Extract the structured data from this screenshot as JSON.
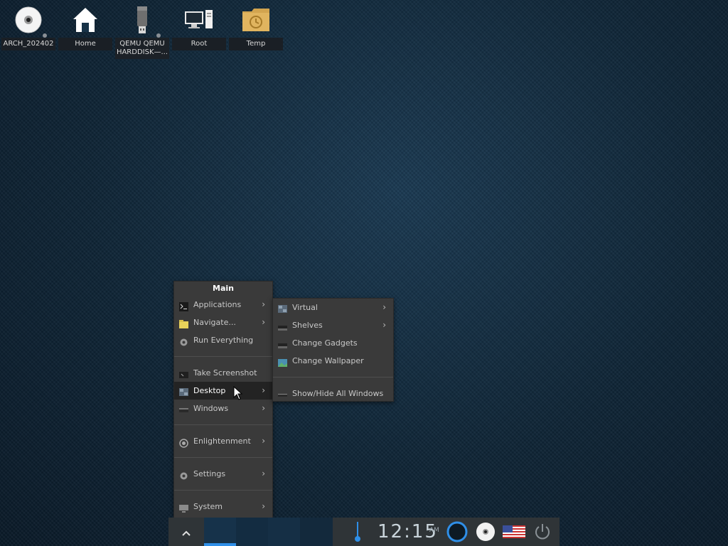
{
  "desktop": {
    "icons": [
      {
        "label": "ARCH_202402",
        "icon": "optical-disc-icon"
      },
      {
        "label": "Home",
        "icon": "home-icon"
      },
      {
        "label": "QEMU QEMU HARDDISK—...",
        "icon": "usb-drive-icon"
      },
      {
        "label": "Root",
        "icon": "computer-icon"
      },
      {
        "label": "Temp",
        "icon": "folder-clock-icon"
      }
    ]
  },
  "main_menu": {
    "title": "Main",
    "items": [
      {
        "label": "Applications",
        "icon": "terminal-icon"
      },
      {
        "label": "Navigate...",
        "icon": "folder-icon"
      },
      {
        "label": "Run Everything",
        "icon": "gear-icon"
      },
      {
        "label": "Take Screenshot",
        "icon": "screenshot-icon"
      },
      {
        "label": "Desktop",
        "icon": "desktop-icon"
      },
      {
        "label": "Windows",
        "icon": "windows-icon"
      },
      {
        "label": "Enlightenment",
        "icon": "enlightenment-icon"
      },
      {
        "label": "Settings",
        "icon": "settings-icon"
      },
      {
        "label": "System",
        "icon": "monitor-icon"
      }
    ]
  },
  "desktop_submenu": {
    "items": [
      {
        "label": "Virtual",
        "icon": "virtual-desktop-icon"
      },
      {
        "label": "Shelves",
        "icon": "shelf-icon"
      },
      {
        "label": "Change Gadgets",
        "icon": "gadget-icon"
      },
      {
        "label": "Change Wallpaper",
        "icon": "wallpaper-icon"
      },
      {
        "label": "Show/Hide All Windows",
        "icon": "show-desktop-icon"
      }
    ]
  },
  "shelf": {
    "start_icon": "chevron-up-icon",
    "clock": "12:15",
    "ampm": "AM",
    "tray_icons": [
      "thermometer-icon",
      "connman-icon",
      "optical-disc-icon",
      "us-flag-icon",
      "power-icon"
    ]
  },
  "colors": {
    "accent": "#2f8fe8",
    "menu_bg": "#3a3a3a",
    "shelf_bg": "#2f3437"
  }
}
